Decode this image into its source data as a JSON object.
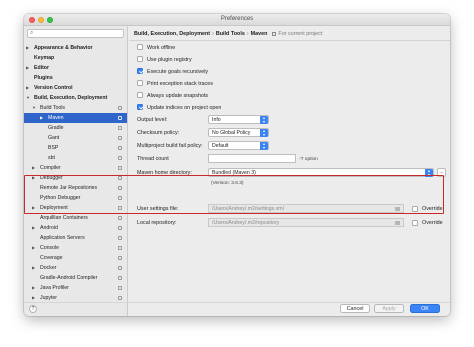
{
  "window": {
    "title": "Preferences"
  },
  "sidebar": {
    "items": [
      {
        "label": "Appearance & Behavior",
        "depth": 0,
        "arrow": "▶",
        "bold": true
      },
      {
        "label": "Keymap",
        "depth": 0,
        "arrow": "",
        "bold": true
      },
      {
        "label": "Editor",
        "depth": 0,
        "arrow": "▶",
        "bold": true
      },
      {
        "label": "Plugins",
        "depth": 0,
        "arrow": "",
        "bold": true
      },
      {
        "label": "Version Control",
        "depth": 0,
        "arrow": "▶",
        "bold": true
      },
      {
        "label": "Build, Execution, Deployment",
        "depth": 0,
        "arrow": "▼",
        "bold": true
      },
      {
        "label": "Build Tools",
        "depth": 1,
        "arrow": "▼",
        "bold": false
      },
      {
        "label": "Maven",
        "depth": 2,
        "arrow": "▶",
        "bold": false,
        "selected": true
      },
      {
        "label": "Gradle",
        "depth": 2,
        "arrow": "",
        "bold": false
      },
      {
        "label": "Gant",
        "depth": 2,
        "arrow": "",
        "bold": false
      },
      {
        "label": "BSP",
        "depth": 2,
        "arrow": "",
        "bold": false
      },
      {
        "label": "sbt",
        "depth": 2,
        "arrow": "",
        "bold": false
      },
      {
        "label": "Compiler",
        "depth": 1,
        "arrow": "▶",
        "bold": false
      },
      {
        "label": "Debugger",
        "depth": 1,
        "arrow": "▶",
        "bold": false
      },
      {
        "label": "Remote Jar Repositories",
        "depth": 1,
        "arrow": "",
        "bold": false
      },
      {
        "label": "Python Debugger",
        "depth": 1,
        "arrow": "",
        "bold": false
      },
      {
        "label": "Deployment",
        "depth": 1,
        "arrow": "▶",
        "bold": false
      },
      {
        "label": "Arquillian Containers",
        "depth": 1,
        "arrow": "",
        "bold": false
      },
      {
        "label": "Android",
        "depth": 1,
        "arrow": "▶",
        "bold": false
      },
      {
        "label": "Application Servers",
        "depth": 1,
        "arrow": "",
        "bold": false
      },
      {
        "label": "Console",
        "depth": 1,
        "arrow": "▶",
        "bold": false
      },
      {
        "label": "Coverage",
        "depth": 1,
        "arrow": "",
        "bold": false
      },
      {
        "label": "Docker",
        "depth": 1,
        "arrow": "▶",
        "bold": false
      },
      {
        "label": "Gradle-Android Compiler",
        "depth": 1,
        "arrow": "",
        "bold": false
      },
      {
        "label": "Java Profiler",
        "depth": 1,
        "arrow": "▶",
        "bold": false
      },
      {
        "label": "Jupyter",
        "depth": 1,
        "arrow": "▶",
        "bold": false
      }
    ]
  },
  "breadcrumb": {
    "items": [
      "Build, Execution, Deployment",
      "Build Tools",
      "Maven"
    ],
    "scope": "For current project"
  },
  "options": {
    "work_offline": {
      "label": "Work offline",
      "checked": false
    },
    "use_plugin_registry": {
      "label": "Use plugin registry",
      "checked": false
    },
    "execute_goals_recursively": {
      "label": "Execute goals recursively",
      "checked": true
    },
    "print_exception_stack_traces": {
      "label": "Print exception stack traces",
      "checked": false
    },
    "always_update_snapshots": {
      "label": "Always update snapshots",
      "checked": false
    },
    "update_indices": {
      "label": "Update indices on project open",
      "checked": true
    }
  },
  "form": {
    "output_level": {
      "label": "Output level:",
      "value": "Info"
    },
    "checksum_policy": {
      "label": "Checksum policy:",
      "value": "No Global Policy"
    },
    "fail_policy": {
      "label": "Multiproject build fail policy:",
      "value": "Default"
    },
    "thread_count": {
      "label": "Thread count",
      "value": "",
      "hint": "-T option"
    },
    "maven_home": {
      "label": "Maven home directory:",
      "value": "Bundled (Maven 3)",
      "browse": "...",
      "version": "(Version: 3.6.3)"
    },
    "user_settings": {
      "label": "User settings file:",
      "value": "/Users/Andrey/.m2/settings.xml",
      "override_label": "Override",
      "override": false
    },
    "local_repository": {
      "label": "Local repository:",
      "value": "/Users/Andrey/.m2/repository",
      "override_label": "Override",
      "override": false
    }
  },
  "footer": {
    "help": "?",
    "cancel": "Cancel",
    "apply": "Apply",
    "ok": "OK"
  },
  "colors": {
    "accent": "#3b84f6",
    "selection": "#2f65ca",
    "highlight_box": "#c52b2b"
  }
}
